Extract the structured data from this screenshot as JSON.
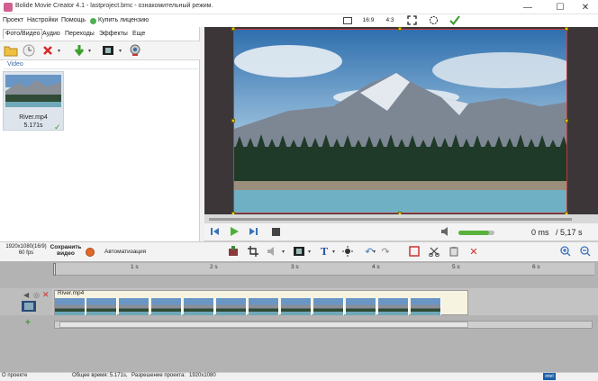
{
  "window": {
    "title": "Bolide Movie Creator 4.1 - lastproject.bmc - ознакомительный режим."
  },
  "menu": {
    "items": [
      "Проект",
      "Настройки",
      "Помощь",
      "Купить лицензию"
    ]
  },
  "aspect": {
    "ratio_169": "16:9",
    "ratio_43": "4:3"
  },
  "tabs": [
    "Фото/Видео",
    "Аудио",
    "Переходы",
    "Эффекты",
    "Еще"
  ],
  "library": {
    "section_label": "Video",
    "items": [
      {
        "name": "River.mp4",
        "duration": "5.171s"
      }
    ]
  },
  "player": {
    "current_time": "0 ms",
    "total_time": "/ 5,17 s",
    "volume": 0.85
  },
  "project": {
    "resolution_info_line1": "1920x1080(16/9)",
    "resolution_info_line2": "60 fps",
    "save_label_line1": "Сохранить",
    "save_label_line2": "видео",
    "automation_label": "Автоматизация"
  },
  "timeline": {
    "ticks": [
      "1 s",
      "2 s",
      "3 s",
      "4 s",
      "5 s",
      "6 s"
    ],
    "clip_name": "River.mp4"
  },
  "status": {
    "left": "О проекте",
    "total_time": "Общее время: 5.171s,",
    "resolution": "Разрешение проекта:",
    "resolution_value": "1920x1080",
    "badge": "intel"
  },
  "colors": {
    "accent": "#3a6ea5",
    "clip_bg": "#f7f3e1",
    "preview_bg": "#3c3638",
    "selection": "#c23a3a"
  }
}
